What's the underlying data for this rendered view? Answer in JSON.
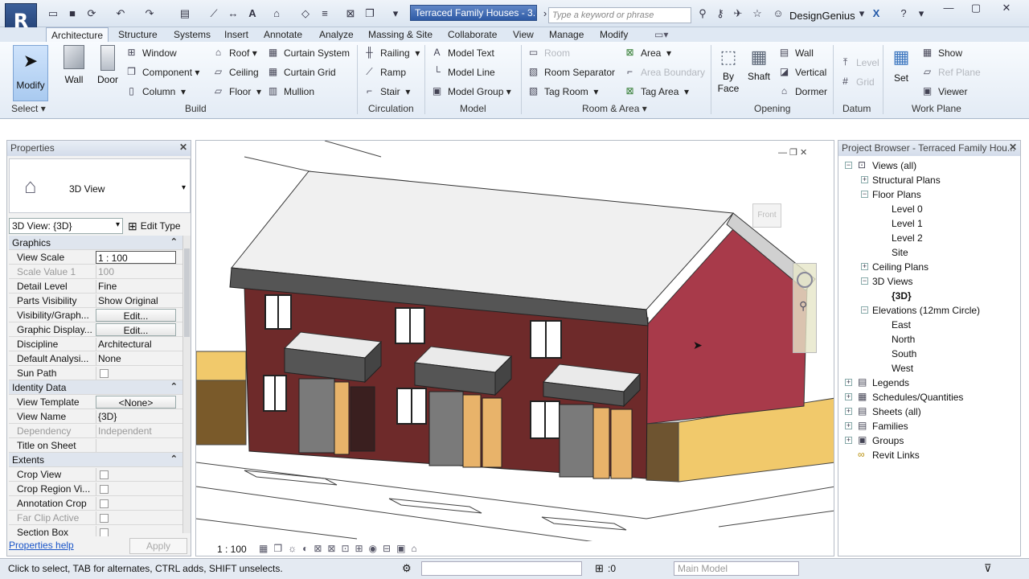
{
  "titlebar": {
    "doc_title": "Terraced Family Houses - 3...",
    "search_placeholder": "Type a keyword or phrase",
    "user": "DesignGenius"
  },
  "tabs": [
    "Architecture",
    "Structure",
    "Systems",
    "Insert",
    "Annotate",
    "Analyze",
    "Massing & Site",
    "Collaborate",
    "View",
    "Manage",
    "Modify"
  ],
  "ribbon": {
    "modify": "Modify",
    "select": "Select",
    "wall": "Wall",
    "door": "Door",
    "build": {
      "window": "Window",
      "component": "Component",
      "column": "Column",
      "roof": "Roof",
      "ceiling": "Ceiling",
      "floor": "Floor",
      "curtain_system": "Curtain System",
      "curtain_grid": "Curtain Grid",
      "mullion": "Mullion",
      "label": "Build"
    },
    "circulation": {
      "railing": "Railing",
      "ramp": "Ramp",
      "stair": "Stair",
      "label": "Circulation"
    },
    "model": {
      "model_text": "Model Text",
      "model_line": "Model Line",
      "model_group": "Model Group",
      "label": "Model"
    },
    "room_area": {
      "room": "Room",
      "room_separator": "Room Separator",
      "tag_room": "Tag Room",
      "area": "Area",
      "area_boundary": "Area Boundary",
      "tag_area": "Tag Area",
      "label": "Room & Area"
    },
    "opening": {
      "by_face": "By Face",
      "shaft": "Shaft",
      "wall": "Wall",
      "vertical": "Vertical",
      "dormer": "Dormer",
      "label": "Opening"
    },
    "datum": {
      "level": "Level",
      "grid": "Grid",
      "label": "Datum"
    },
    "work_plane": {
      "set": "Set",
      "show": "Show",
      "ref_plane": "Ref Plane",
      "viewer": "Viewer",
      "label": "Work Plane"
    }
  },
  "properties": {
    "title": "Properties",
    "type_name": "3D View",
    "selector": "3D View: {3D}",
    "edit_type": "Edit Type",
    "rows": [
      {
        "k": "Graphics",
        "v": "",
        "group": true
      },
      {
        "k": "View Scale",
        "v": "1 : 100"
      },
      {
        "k": "Scale Value    1",
        "v": "100",
        "dim": true
      },
      {
        "k": "Detail Level",
        "v": "Fine"
      },
      {
        "k": "Parts Visibility",
        "v": "Show Original"
      },
      {
        "k": "Visibility/Graph...",
        "v": "Edit...",
        "btn": true
      },
      {
        "k": "Graphic Display...",
        "v": "Edit...",
        "btn": true
      },
      {
        "k": "Discipline",
        "v": "Architectural"
      },
      {
        "k": "Default Analysi...",
        "v": "None"
      },
      {
        "k": "Sun Path",
        "v": "",
        "chk": true
      },
      {
        "k": "Identity Data",
        "v": "",
        "group": true
      },
      {
        "k": "View Template",
        "v": "<None>",
        "btn": true
      },
      {
        "k": "View Name",
        "v": "{3D}"
      },
      {
        "k": "Dependency",
        "v": "Independent",
        "dim": true
      },
      {
        "k": "Title on Sheet",
        "v": ""
      },
      {
        "k": "Extents",
        "v": "",
        "group": true
      },
      {
        "k": "Crop View",
        "v": "",
        "chk": true
      },
      {
        "k": "Crop Region Vi...",
        "v": "",
        "chk": true
      },
      {
        "k": "Annotation Crop",
        "v": "",
        "chk": true
      },
      {
        "k": "Far Clip Active",
        "v": "",
        "chk": true,
        "dim": true
      },
      {
        "k": "Section Box",
        "v": "",
        "chk": true
      }
    ],
    "help": "Properties help",
    "apply": "Apply"
  },
  "viewport": {
    "scale": "1 : 100",
    "viewcube": "Front"
  },
  "project_browser": {
    "title": "Project Browser - Terraced Family Hou...",
    "nodes": [
      {
        "t": "Views (all)",
        "d": 0,
        "e": "-"
      },
      {
        "t": "Structural Plans",
        "d": 1,
        "e": "+"
      },
      {
        "t": "Floor Plans",
        "d": 1,
        "e": "-"
      },
      {
        "t": "Level 0",
        "d": 2,
        "e": ""
      },
      {
        "t": "Level 1",
        "d": 2,
        "e": ""
      },
      {
        "t": "Level 2",
        "d": 2,
        "e": ""
      },
      {
        "t": "Site",
        "d": 2,
        "e": ""
      },
      {
        "t": "Ceiling Plans",
        "d": 1,
        "e": "+"
      },
      {
        "t": "3D Views",
        "d": 1,
        "e": "-"
      },
      {
        "t": "{3D}",
        "d": 2,
        "e": "",
        "bold": true
      },
      {
        "t": "Elevations (12mm Circle)",
        "d": 1,
        "e": "-"
      },
      {
        "t": "East",
        "d": 2,
        "e": ""
      },
      {
        "t": "North",
        "d": 2,
        "e": ""
      },
      {
        "t": "South",
        "d": 2,
        "e": ""
      },
      {
        "t": "West",
        "d": 2,
        "e": ""
      },
      {
        "t": "Legends",
        "d": 0,
        "e": "+"
      },
      {
        "t": "Schedules/Quantities",
        "d": 0,
        "e": "+"
      },
      {
        "t": "Sheets (all)",
        "d": 0,
        "e": "+"
      },
      {
        "t": "Families",
        "d": 0,
        "e": "+"
      },
      {
        "t": "Groups",
        "d": 0,
        "e": "+"
      },
      {
        "t": "Revit Links",
        "d": 0,
        "e": ""
      }
    ]
  },
  "status": {
    "text": "Click to select, TAB for alternates, CTRL adds, SHIFT unselects.",
    "zero": ":0",
    "model": "Main Model"
  },
  "colors": {
    "brick": "#6e2a2a",
    "gable": "#a83a4a",
    "roof": "#f0f0f0",
    "fascia": "#5a5a5a",
    "yellow_wall": "#f1c96b",
    "door": "#e8b36a"
  }
}
